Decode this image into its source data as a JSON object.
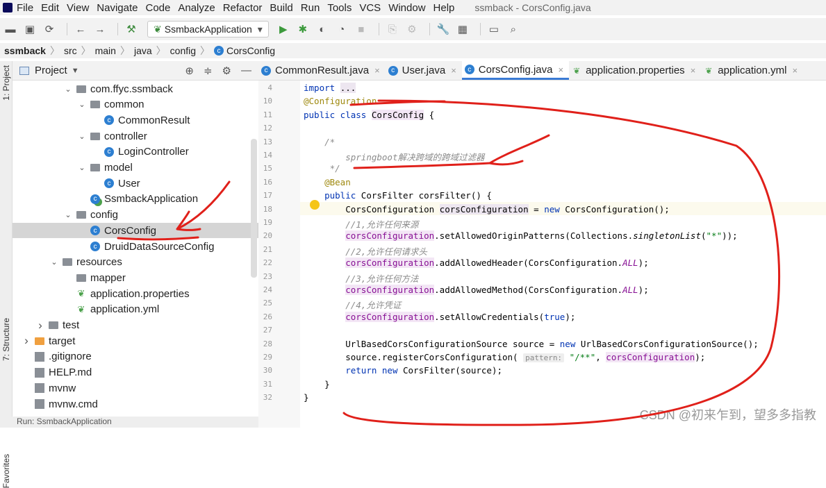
{
  "menu": [
    "File",
    "Edit",
    "View",
    "Navigate",
    "Code",
    "Analyze",
    "Refactor",
    "Build",
    "Run",
    "Tools",
    "VCS",
    "Window",
    "Help"
  ],
  "window_title": "ssmback - CorsConfig.java",
  "toolbar": {
    "run_config": "SsmbackApplication"
  },
  "breadcrumb": [
    "ssmback",
    "src",
    "main",
    "java",
    "config",
    "CorsConfig"
  ],
  "project_panel": {
    "title": "Project"
  },
  "tree": [
    {
      "label": "com.ffyc.ssmback",
      "kind": "package",
      "depth": 4,
      "arrow": "v"
    },
    {
      "label": "common",
      "kind": "package",
      "depth": 5,
      "arrow": "v"
    },
    {
      "label": "CommonResult",
      "kind": "class",
      "depth": 6
    },
    {
      "label": "controller",
      "kind": "package",
      "depth": 5,
      "arrow": "v"
    },
    {
      "label": "LoginController",
      "kind": "class",
      "depth": 6
    },
    {
      "label": "model",
      "kind": "package",
      "depth": 5,
      "arrow": "v"
    },
    {
      "label": "User",
      "kind": "class",
      "depth": 6
    },
    {
      "label": "SsmbackApplication",
      "kind": "app",
      "depth": 5
    },
    {
      "label": "config",
      "kind": "package",
      "depth": 4,
      "arrow": "v"
    },
    {
      "label": "CorsConfig",
      "kind": "class",
      "depth": 5,
      "selected": true
    },
    {
      "label": "DruidDataSourceConfig",
      "kind": "class",
      "depth": 5
    },
    {
      "label": "resources",
      "kind": "folder",
      "depth": 3,
      "arrow": "v"
    },
    {
      "label": "mapper",
      "kind": "folder",
      "depth": 4
    },
    {
      "label": "application.properties",
      "kind": "props",
      "depth": 4
    },
    {
      "label": "application.yml",
      "kind": "props",
      "depth": 4
    },
    {
      "label": "test",
      "kind": "folder",
      "depth": 2,
      "arrow": ">"
    },
    {
      "label": "target",
      "kind": "folder-orange",
      "depth": 1,
      "arrow": ">"
    },
    {
      "label": ".gitignore",
      "kind": "file",
      "depth": 1
    },
    {
      "label": "HELP.md",
      "kind": "file",
      "depth": 1
    },
    {
      "label": "mvnw",
      "kind": "file",
      "depth": 1
    },
    {
      "label": "mvnw.cmd",
      "kind": "file",
      "depth": 1
    }
  ],
  "tabs": [
    {
      "label": "CommonResult.java",
      "icon": "class-icon"
    },
    {
      "label": "User.java",
      "icon": "class-icon"
    },
    {
      "label": "CorsConfig.java",
      "icon": "class-icon",
      "active": true
    },
    {
      "label": "application.properties",
      "icon": "properties-icon"
    },
    {
      "label": "application.yml",
      "icon": "properties-icon"
    }
  ],
  "code_lines": [
    {
      "n": "4",
      "html": "<span class='kw'>import</span> <span class='hlc'>...</span>"
    },
    {
      "n": "10",
      "html": "<span class='ann'>@Configuration</span>"
    },
    {
      "n": "11",
      "html": "<span class='kw'>public class</span> <span class='hl'>CorsConfig</span> {"
    },
    {
      "n": "12",
      "html": ""
    },
    {
      "n": "13",
      "html": "    <span class='cmt'>/*</span>"
    },
    {
      "n": "14",
      "html": "        <span class='cmt'>springboot解决跨域的跨域过滤器</span>"
    },
    {
      "n": "15",
      "html": "     <span class='cmt'>*/</span>"
    },
    {
      "n": "16",
      "html": "    <span class='ann'>@Bean</span>"
    },
    {
      "n": "17",
      "html": "    <span class='kw'>public</span> CorsFilter corsFilter() {"
    },
    {
      "n": "18",
      "html": "        CorsConfiguration <span class='hlc'>corsConfiguration</span> = <span class='kw'>new</span> CorsConfiguration();"
    },
    {
      "n": "19",
      "html": "        <span class='cmt'>//1,允许任何来源</span>"
    },
    {
      "n": "20",
      "html": "        <span class='hl fld'>corsConfiguration</span>.setAllowedOriginPatterns(Collections.<i>singletonList</i>(<span class='str'>\"*\"</span>));"
    },
    {
      "n": "21",
      "html": "        <span class='cmt'>//2,允许任何请求头</span>"
    },
    {
      "n": "22",
      "html": "        <span class='hl fld'>corsConfiguration</span>.addAllowedHeader(CorsConfiguration.<span class='fld-b'>ALL</span>);"
    },
    {
      "n": "23",
      "html": "        <span class='cmt'>//3,允许任何方法</span>"
    },
    {
      "n": "24",
      "html": "        <span class='hl fld'>corsConfiguration</span>.addAllowedMethod(CorsConfiguration.<span class='fld-b'>ALL</span>);"
    },
    {
      "n": "25",
      "html": "        <span class='cmt'>//4,允许凭证</span>"
    },
    {
      "n": "26",
      "html": "        <span class='hl fld'>corsConfiguration</span>.setAllowCredentials(<span class='kw'>true</span>);"
    },
    {
      "n": "27",
      "html": ""
    },
    {
      "n": "28",
      "html": "        UrlBasedCorsConfigurationSource source = <span class='kw'>new</span> UrlBasedCorsConfigurationSource();"
    },
    {
      "n": "29",
      "html": "        source.registerCorsConfiguration( <span class='hint'>pattern:</span> <span class='str'>\"/**\"</span>, <span class='hl fld'>corsConfiguration</span>);"
    },
    {
      "n": "30",
      "html": "        <span class='kw'>return new</span> CorsFilter(source);"
    },
    {
      "n": "31",
      "html": "    }"
    },
    {
      "n": "32",
      "html": "}"
    }
  ],
  "bottom_bar": "Run:   SsmbackApplication",
  "watermark": "CSDN @初来乍到，望多多指教",
  "side_strip_labels": [
    "1: Project",
    "7: Structure",
    "Favorites"
  ]
}
